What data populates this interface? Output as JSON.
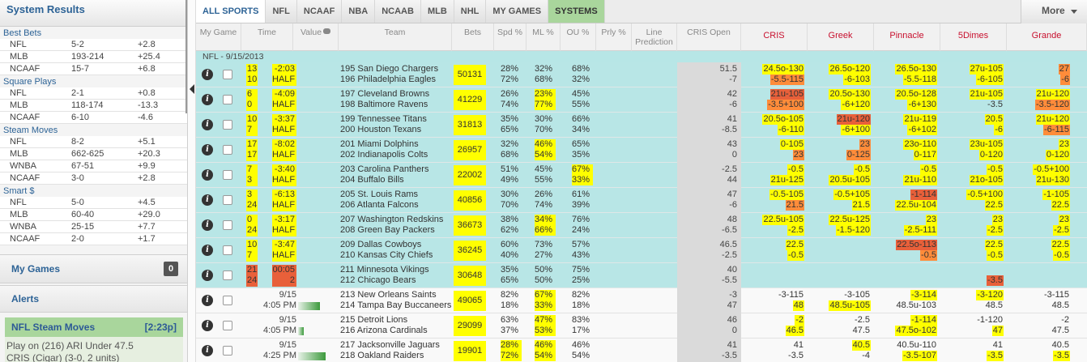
{
  "sidebar": {
    "title": "System Results",
    "sections": [
      {
        "name": "Best Bets",
        "rows": [
          [
            "NFL",
            "5-2",
            "+2.8"
          ],
          [
            "MLB",
            "193-214",
            "+25.4"
          ],
          [
            "NCAAF",
            "15-7",
            "+6.8"
          ]
        ]
      },
      {
        "name": "Square Plays",
        "rows": [
          [
            "NFL",
            "2-1",
            "+0.8"
          ],
          [
            "MLB",
            "118-174",
            "-13.3"
          ],
          [
            "NCAAF",
            "6-10",
            "-4.6"
          ]
        ]
      },
      {
        "name": "Steam Moves",
        "rows": [
          [
            "NFL",
            "8-2",
            "+5.1"
          ],
          [
            "MLB",
            "662-625",
            "+20.3"
          ],
          [
            "WNBA",
            "67-51",
            "+9.9"
          ],
          [
            "NCAAF",
            "3-0",
            "+2.8"
          ]
        ]
      },
      {
        "name": "Smart $",
        "rows": [
          [
            "NFL",
            "5-0",
            "+4.5"
          ],
          [
            "MLB",
            "60-40",
            "+29.0"
          ],
          [
            "WNBA",
            "25-15",
            "+7.7"
          ],
          [
            "NCAAF",
            "2-0",
            "+1.7"
          ]
        ]
      }
    ],
    "my_games_label": "My Games",
    "my_games_count": "0",
    "alerts_label": "Alerts",
    "steam_panel": {
      "title": "NFL Steam Moves",
      "time": "[2:23p]",
      "line1": "Play on (216) ARI Under 47.5",
      "line2": "CRIS (Cigar) (3-0, 2 units)"
    }
  },
  "tabs": [
    "ALL SPORTS",
    "NFL",
    "NCAAF",
    "NBA",
    "NCAAB",
    "MLB",
    "NHL",
    "MY GAMES",
    "SYSTEMS"
  ],
  "more_label": "More",
  "headers": {
    "my_game": "My Game",
    "time": "Time",
    "value": "Value",
    "team": "Team",
    "bets": "Bets",
    "spd": "Spd %",
    "ml": "ML %",
    "ou": "OU %",
    "prly": "Prly %",
    "line_pred": "Line Prediction",
    "cris_open": "CRIS Open",
    "books": [
      "CRIS",
      "Greek",
      "Pinnacle",
      "5Dimes",
      "Grande"
    ]
  },
  "date_label": "NFL - 9/15/2013",
  "games": [
    {
      "status": "live",
      "score": [
        "13",
        "10"
      ],
      "clock": [
        "-2:03",
        "HALF"
      ],
      "teams": [
        "195 San Diego Chargers",
        "196 Philadelphia Eagles"
      ],
      "bets": "50131",
      "spd": [
        "28%",
        "72%"
      ],
      "ml": [
        "32%",
        "68%"
      ],
      "ou": [
        "68%",
        "32%"
      ],
      "open": [
        "51.5",
        "-7"
      ],
      "books": [
        [
          [
            "24.5o-130",
            "y"
          ],
          [
            "-5.5-115",
            "o"
          ]
        ],
        [
          [
            "26.5o-120",
            "y"
          ],
          [
            "-6-103",
            "y"
          ]
        ],
        [
          [
            "26.5o-130",
            "y"
          ],
          [
            "-5.5-118",
            "y"
          ]
        ],
        [
          [
            "27u-105",
            "y"
          ],
          [
            "-6-105",
            "y"
          ]
        ],
        [
          [
            "27",
            "o"
          ],
          [
            "-6",
            "o"
          ]
        ]
      ]
    },
    {
      "status": "live",
      "score": [
        "6",
        "0"
      ],
      "clock": [
        "-4:09",
        "HALF"
      ],
      "teams": [
        "197 Cleveland Browns",
        "198 Baltimore Ravens"
      ],
      "bets": "41229",
      "spd": [
        "26%",
        "74%"
      ],
      "ml": [
        "23%",
        "77%"
      ],
      "ou": [
        "45%",
        "55%"
      ],
      "open": [
        "42",
        "-6"
      ],
      "books": [
        [
          [
            "21u-105",
            "r"
          ],
          [
            "-3.5+100",
            "o"
          ]
        ],
        [
          [
            "20.5o-130",
            "y"
          ],
          [
            "-6+120",
            "y"
          ]
        ],
        [
          [
            "20.5o-128",
            "y"
          ],
          [
            "-6+130",
            "y"
          ]
        ],
        [
          [
            "21u-105",
            "y"
          ],
          [
            "-3.5",
            ""
          ]
        ],
        [
          [
            "21u-120",
            "y"
          ],
          [
            "-3.5-120",
            "o"
          ]
        ]
      ]
    },
    {
      "status": "live",
      "score": [
        "10",
        "7"
      ],
      "clock": [
        "-3:37",
        "HALF"
      ],
      "teams": [
        "199 Tennessee Titans",
        "200 Houston Texans"
      ],
      "bets": "31813",
      "spd": [
        "35%",
        "65%"
      ],
      "ml": [
        "30%",
        "70%"
      ],
      "ou": [
        "66%",
        "34%"
      ],
      "open": [
        "41",
        "-8.5"
      ],
      "books": [
        [
          [
            "20.5o-105",
            "y"
          ],
          [
            "-6-110",
            "y"
          ]
        ],
        [
          [
            "21u-120",
            "r"
          ],
          [
            "-6+100",
            "y"
          ]
        ],
        [
          [
            "21u-119",
            "y"
          ],
          [
            "-6+102",
            "y"
          ]
        ],
        [
          [
            "20.5",
            "y"
          ],
          [
            "-6",
            "y"
          ]
        ],
        [
          [
            "21u-120",
            "y"
          ],
          [
            "-6-115",
            "o"
          ]
        ]
      ]
    },
    {
      "status": "live",
      "score": [
        "17",
        "17"
      ],
      "clock": [
        "-8:02",
        "HALF"
      ],
      "teams": [
        "201 Miami Dolphins",
        "202 Indianapolis Colts"
      ],
      "bets": "26957",
      "spd": [
        "32%",
        "68%"
      ],
      "ml": [
        "46%",
        "54%"
      ],
      "ou": [
        "65%",
        "35%"
      ],
      "open": [
        "43",
        "0"
      ],
      "books": [
        [
          [
            "0-105",
            "y"
          ],
          [
            "23",
            "o"
          ]
        ],
        [
          [
            "23",
            "o"
          ],
          [
            "0-125",
            "o"
          ]
        ],
        [
          [
            "23o-110",
            "y"
          ],
          [
            "0-117",
            "y"
          ]
        ],
        [
          [
            "23u-105",
            "y"
          ],
          [
            "0-120",
            "y"
          ]
        ],
        [
          [
            "23",
            "y"
          ],
          [
            "0-120",
            "y"
          ]
        ]
      ]
    },
    {
      "status": "live",
      "score": [
        "7",
        "3"
      ],
      "clock": [
        "-3:40",
        "HALF"
      ],
      "teams": [
        "203 Carolina Panthers",
        "204 Buffalo Bills"
      ],
      "bets": "22002",
      "spd": [
        "51%",
        "49%"
      ],
      "ml": [
        "45%",
        "55%"
      ],
      "ou": [
        "67%",
        "33%"
      ],
      "open": [
        "-2.5",
        "44"
      ],
      "books": [
        [
          [
            "-0.5",
            "y"
          ],
          [
            "21u-125",
            "y"
          ]
        ],
        [
          [
            "-0.5",
            "y"
          ],
          [
            "20.5u-105",
            "y"
          ]
        ],
        [
          [
            "-0.5",
            "y"
          ],
          [
            "21u-110",
            "y"
          ]
        ],
        [
          [
            "-0.5",
            "y"
          ],
          [
            "21o-105",
            "y"
          ]
        ],
        [
          [
            "-0.5+100",
            "y"
          ],
          [
            "21u-130",
            "y"
          ]
        ]
      ]
    },
    {
      "status": "live",
      "score": [
        "3",
        "24"
      ],
      "clock": [
        "-6:13",
        "HALF"
      ],
      "teams": [
        "205 St. Louis Rams",
        "206 Atlanta Falcons"
      ],
      "bets": "40856",
      "spd": [
        "30%",
        "70%"
      ],
      "ml": [
        "26%",
        "74%"
      ],
      "ou": [
        "61%",
        "39%"
      ],
      "open": [
        "47",
        "-6"
      ],
      "books": [
        [
          [
            "-0.5-105",
            "y"
          ],
          [
            "21.5",
            "o"
          ]
        ],
        [
          [
            "-0.5+105",
            "y"
          ],
          [
            "21.5",
            "y"
          ]
        ],
        [
          [
            "-1-114",
            "r"
          ],
          [
            "22.5u-104",
            "y"
          ]
        ],
        [
          [
            "-0.5+100",
            "y"
          ],
          [
            "22.5",
            "y"
          ]
        ],
        [
          [
            "-1-105",
            "y"
          ],
          [
            "22.5",
            "y"
          ]
        ]
      ]
    },
    {
      "status": "live",
      "score": [
        "0",
        "24"
      ],
      "clock": [
        "-3:17",
        "HALF"
      ],
      "teams": [
        "207 Washington Redskins",
        "208 Green Bay Packers"
      ],
      "bets": "36673",
      "spd": [
        "38%",
        "62%"
      ],
      "ml": [
        "34%",
        "66%"
      ],
      "ou": [
        "76%",
        "24%"
      ],
      "open": [
        "48",
        "-6.5"
      ],
      "books": [
        [
          [
            "22.5u-105",
            "y"
          ],
          [
            "-2.5",
            "y"
          ]
        ],
        [
          [
            "22.5u-125",
            "y"
          ],
          [
            "-1.5-120",
            "y"
          ]
        ],
        [
          [
            "23",
            "y"
          ],
          [
            "-2.5-111",
            "y"
          ]
        ],
        [
          [
            "23",
            "y"
          ],
          [
            "-2.5",
            "y"
          ]
        ],
        [
          [
            "23",
            "y"
          ],
          [
            "-2.5",
            "y"
          ]
        ]
      ]
    },
    {
      "status": "live",
      "score": [
        "10",
        "7"
      ],
      "clock": [
        "-3:47",
        "HALF"
      ],
      "teams": [
        "209 Dallas Cowboys",
        "210 Kansas City Chiefs"
      ],
      "bets": "36245",
      "spd": [
        "60%",
        "40%"
      ],
      "ml": [
        "73%",
        "27%"
      ],
      "ou": [
        "57%",
        "43%"
      ],
      "open": [
        "46.5",
        "-2.5"
      ],
      "books": [
        [
          [
            "22.5",
            "y"
          ],
          [
            "-0.5",
            "y"
          ]
        ],
        [
          [
            "",
            ""
          ],
          [
            "",
            ""
          ]
        ],
        [
          [
            "22.5o-113",
            "r"
          ],
          [
            "-0.5",
            "o"
          ]
        ],
        [
          [
            "22.5",
            "y"
          ],
          [
            "-0.5",
            "y"
          ]
        ],
        [
          [
            "22.5",
            "y"
          ],
          [
            "-0.5",
            "y"
          ]
        ]
      ]
    },
    {
      "status": "final",
      "score": [
        "21",
        "24"
      ],
      "clock": [
        "00:05",
        "2"
      ],
      "teams": [
        "211 Minnesota Vikings",
        "212 Chicago Bears"
      ],
      "bets": "30648",
      "spd": [
        "35%",
        "65%"
      ],
      "ml": [
        "50%",
        "50%"
      ],
      "ou": [
        "75%",
        "25%"
      ],
      "open": [
        "40",
        "-5.5"
      ],
      "books": [
        [
          [
            "",
            ""
          ],
          [
            "",
            ""
          ]
        ],
        [
          [
            "",
            ""
          ],
          [
            "",
            ""
          ]
        ],
        [
          [
            "",
            ""
          ],
          [
            "",
            ""
          ]
        ],
        [
          [
            "",
            ""
          ],
          [
            "-3.5",
            "r"
          ]
        ],
        [
          [
            "",
            ""
          ],
          [
            "",
            ""
          ]
        ]
      ]
    },
    {
      "status": "sched",
      "time": [
        "9/15",
        "4:05 PM"
      ],
      "value": 0.75,
      "teams": [
        "213 New Orleans Saints",
        "214 Tampa Bay Buccaneers"
      ],
      "bets": "49065",
      "spd": [
        "82%",
        "18%"
      ],
      "ml": [
        "67%",
        "33%"
      ],
      "ou": [
        "82%",
        "18%"
      ],
      "open": [
        "-3",
        "47"
      ],
      "books": [
        [
          [
            "-3-115",
            ""
          ],
          [
            "48",
            "y"
          ]
        ],
        [
          [
            "-3-105",
            ""
          ],
          [
            "48.5u-105",
            "y"
          ]
        ],
        [
          [
            "-3-114",
            "y"
          ],
          [
            "48.5u-103",
            ""
          ]
        ],
        [
          [
            "-3-120",
            "y"
          ],
          [
            "48.5",
            ""
          ]
        ],
        [
          [
            "-3-115",
            ""
          ],
          [
            "48.5",
            ""
          ]
        ]
      ]
    },
    {
      "status": "sched",
      "time": [
        "9/15",
        "4:05 PM"
      ],
      "value": 0.2,
      "teams": [
        "215 Detroit Lions",
        "216 Arizona Cardinals"
      ],
      "bets": "29099",
      "spd": [
        "63%",
        "37%"
      ],
      "ml": [
        "47%",
        "53%"
      ],
      "ou": [
        "83%",
        "17%"
      ],
      "open": [
        "46",
        "0"
      ],
      "books": [
        [
          [
            "-2",
            "y"
          ],
          [
            "46.5",
            "y"
          ]
        ],
        [
          [
            "-2.5",
            ""
          ],
          [
            "47.5",
            ""
          ]
        ],
        [
          [
            "-1-114",
            "y"
          ],
          [
            "47.5o-102",
            "y"
          ]
        ],
        [
          [
            "-1-120",
            ""
          ],
          [
            "47",
            "y"
          ]
        ],
        [
          [
            "-2",
            ""
          ],
          [
            "47.5",
            ""
          ]
        ]
      ]
    },
    {
      "status": "sched",
      "time": [
        "9/15",
        "4:25 PM"
      ],
      "value": 0.95,
      "teams": [
        "217 Jacksonville Jaguars",
        "218 Oakland Raiders"
      ],
      "bets": "19901",
      "spd": [
        "28%",
        "72%"
      ],
      "ml": [
        "46%",
        "54%"
      ],
      "ou": [
        "46%",
        "54%"
      ],
      "open": [
        "41",
        "-3.5"
      ],
      "books": [
        [
          [
            "41",
            ""
          ],
          [
            "-3.5",
            ""
          ]
        ],
        [
          [
            "40.5",
            "y"
          ],
          [
            "-4",
            ""
          ]
        ],
        [
          [
            "40.5u-110",
            ""
          ],
          [
            "-3.5-107",
            "y"
          ]
        ],
        [
          [
            "41",
            ""
          ],
          [
            "-3.5",
            "y"
          ]
        ],
        [
          [
            "40.5",
            ""
          ],
          [
            "-3.5",
            "y"
          ]
        ]
      ]
    }
  ]
}
